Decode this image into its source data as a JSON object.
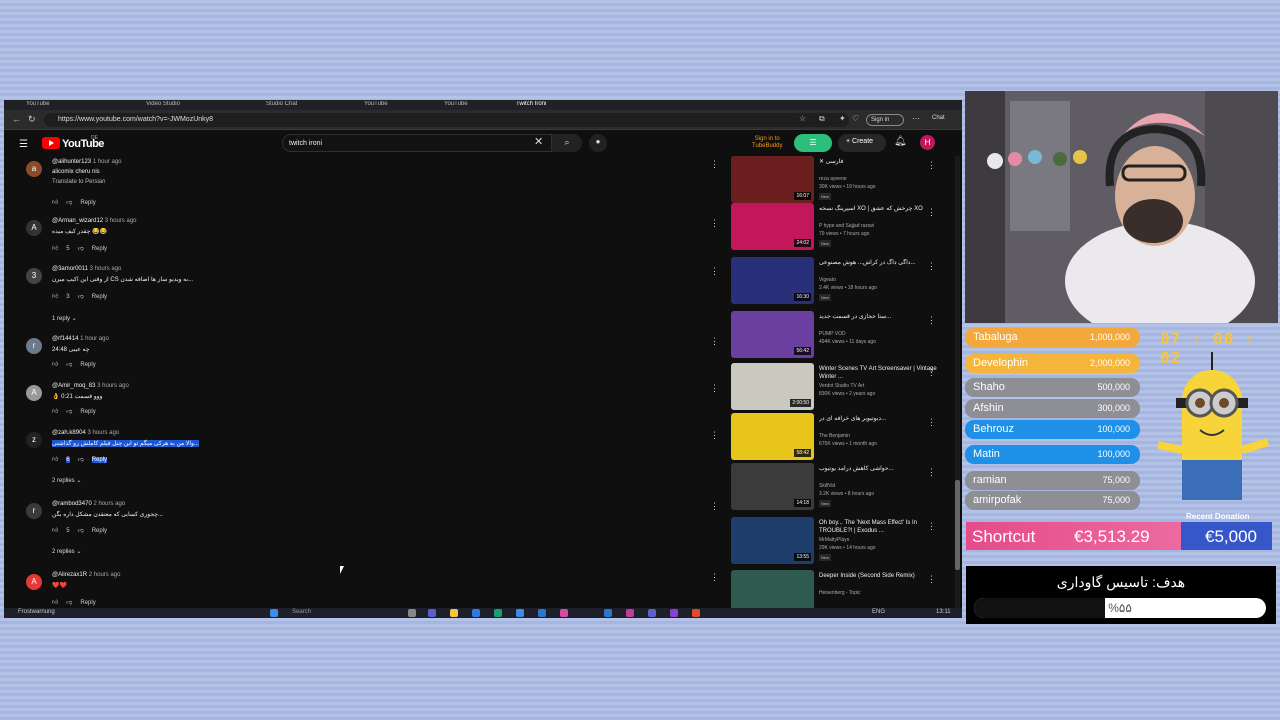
{
  "browser": {
    "tabs": [
      "YouTube",
      "Video Studio",
      "Studio Chat",
      "YouTube",
      "YouTube",
      "Twitch Ironi"
    ],
    "url": "https://www.youtube.com/watch?v=-JWMozUnky8",
    "signin": "Sign in",
    "chat": "Chat"
  },
  "yt": {
    "logo": "YouTube",
    "country": "DE",
    "search_value": "twitch ironi",
    "tubebuddy": "Sign in to\nTubeBuddy",
    "create": "+ Create",
    "avatar_letter": "H"
  },
  "comments": [
    {
      "user": "@alihunter123",
      "ago": "1 hour ago",
      "avatar": "a",
      "avatar_color": "#8a4b2a",
      "text": "alicomix cheru nis",
      "translate": "Translate to Persian",
      "likes": "",
      "reply": "Reply"
    },
    {
      "user": "@Arman_wizard12",
      "ago": "3 hours ago",
      "avatar": "A",
      "avatar_color": "#333333",
      "text": "چقدر کیف میده 😂😂",
      "likes": "5",
      "reply": "Reply"
    },
    {
      "user": "@3amor0011",
      "ago": "3 hours ago",
      "avatar": "3",
      "avatar_color": "#444444",
      "text": "از وقتی این اکیپ میرن CS به ویدیو ساز ها اضافه شدن...",
      "likes": "3",
      "reply": "Reply",
      "replies": "1 reply"
    },
    {
      "user": "@rf14414",
      "ago": "1 hour ago",
      "avatar": "r",
      "avatar_color": "#6b7b8c",
      "text": "چه عیبی 24:48",
      "likes": "",
      "reply": "Reply"
    },
    {
      "user": "@Amir_moq_83",
      "ago": "3 hours ago",
      "avatar": "A",
      "avatar_color": "#999999",
      "text": "👌 ووو قسمت 0:21",
      "likes": "",
      "reply": "Reply"
    },
    {
      "user": "@zah.k8904",
      "ago": "3 hours ago",
      "avatar": "z",
      "avatar_color": "#222222",
      "text": "والا من به هرکی میگم تو این چنل فیلم کاملش رو گذاشتی...",
      "likes": "6",
      "reply": "Reply",
      "replies": "2 replies",
      "highlight": true
    },
    {
      "user": "@rambod3470",
      "ago": "2 hours ago",
      "avatar": "r",
      "avatar_color": "#3a3a3a",
      "text": "چجوری کسایی که معتقدن مشکل داره بگن...",
      "likes": "5",
      "reply": "Reply",
      "replies": "2 replies"
    },
    {
      "user": "@Alirezax1R",
      "ago": "2 hours ago",
      "avatar": "A",
      "avatar_color": "#e53935",
      "text": "❤️❤️",
      "likes": "",
      "reply": "Reply"
    }
  ],
  "recs": [
    {
      "title": "✕ فارسی",
      "channel": "reza ayeene",
      "meta": "30K views • 19 hours ago",
      "new": "New",
      "dur": "16:07",
      "thumb": "#6b1f1f"
    },
    {
      "title": "اسپرینگ نسخه XO | چرخش که عشق XO",
      "channel": "P hype and Sajjad razavi",
      "meta": "79 views • 7 hours ago",
      "new": "New",
      "dur": "24:02",
      "thumb": "#c2185b"
    },
    {
      "title": "داگی داگ در کراش... هوش مصنوعی...",
      "channel": "Vigeato",
      "meta": "2.4K views • 18 hours ago",
      "new": "New",
      "dur": "16:30",
      "thumb": "#2a2f7a"
    },
    {
      "title": "ستا حجازی در قسمت جدید...",
      "channel": "PUMP VOD",
      "meta": "494K views • 11 days ago",
      "new": "",
      "dur": "56:42",
      "thumb": "#6a3fa0"
    },
    {
      "title": "Winter Scenes TV Art Screensaver | Vintage Winter ...",
      "channel": "Verdot Studio TV Art",
      "meta": "830K views • 2 years ago",
      "new": "",
      "dur": "2:00:50",
      "thumb": "#c9c9c0"
    },
    {
      "title": "دیوتیوبر های خرافه ای در...",
      "channel": "The Benjamin",
      "meta": "675K views • 1 month ago",
      "new": "",
      "dur": "58:42",
      "thumb": "#e8c51a"
    },
    {
      "title": "حواشی کاهش درآمد یوتیوب...",
      "channel": "SkillVid",
      "meta": "3.2K views • 8 hours ago",
      "new": "New",
      "dur": "14:18",
      "thumb": "#3b3b3b"
    },
    {
      "title": "Oh boy... The 'Next Mass Effect' Is In TROUBLE?! | Exodus ...",
      "channel": "MrMattyPlays",
      "meta": "29K views • 14 hours ago",
      "new": "New",
      "dur": "13:55",
      "thumb": "#1d3d6b"
    },
    {
      "title": "Deeper Inside (Second Side Remix)",
      "channel": "Heisenberg - Topic",
      "meta": "",
      "new": "",
      "dur": "",
      "thumb": "#2f5a4f"
    }
  ],
  "taskbar": {
    "weather": "Frostwarnung",
    "search": "Search",
    "lang": "ENG",
    "time": "13:11"
  },
  "overlay": {
    "timer": "07 : 00 : 02",
    "donors": [
      {
        "name": "Tabaluga",
        "amount": "1,000,000",
        "color": "#f2a83a"
      },
      {
        "name": "Develophin",
        "amount": "2,000,000",
        "color": "#f5b53a"
      },
      {
        "name": "Shaho",
        "amount": "500,000",
        "color": "#8e8e95"
      },
      {
        "name": "Afshin",
        "amount": "300,000",
        "color": "#8e8e95"
      },
      {
        "name": "Behrouz",
        "amount": "100,000",
        "color": "#1e90e8"
      },
      {
        "name": "Matin",
        "amount": "100,000",
        "color": "#1e90e8"
      },
      {
        "name": "ramian",
        "amount": "75,000",
        "color": "#8e8e95"
      },
      {
        "name": "amirpofak",
        "amount": "75,000",
        "color": "#8e8e95"
      }
    ],
    "shortcut": {
      "name": "Shortcut",
      "amount": "€3,513.29",
      "goal": "€5,000"
    },
    "goal": {
      "title": "هدف: تاسیس گاوداری",
      "percent_label": "%۵۵",
      "fraction": 0.55
    },
    "banner_peek": "Recent Donation"
  },
  "colors": {
    "yt_red": "#ff0000",
    "highlight": "#1c57d6",
    "tubebuddy": "#2dbd7c"
  }
}
